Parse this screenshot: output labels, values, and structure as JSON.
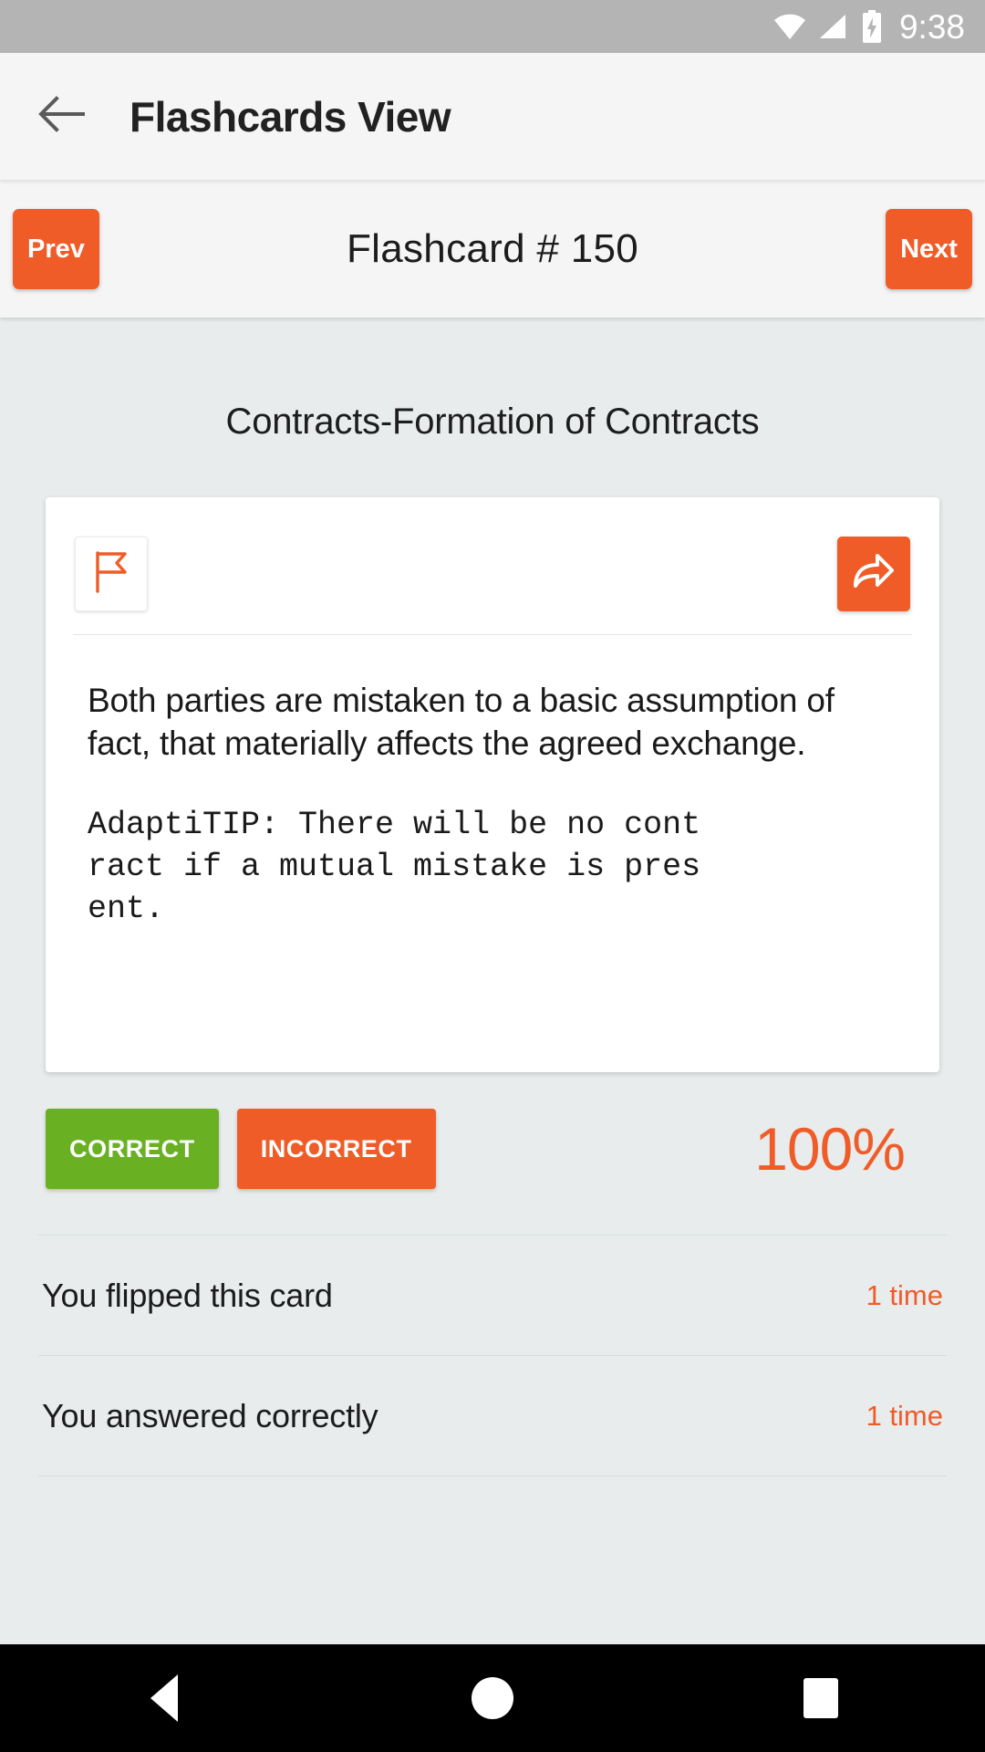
{
  "status_bar": {
    "time": "9:38",
    "icons": [
      "wifi-icon",
      "cell-signal-icon",
      "battery-charging-icon"
    ]
  },
  "app_bar": {
    "back_icon": "arrow-left-icon",
    "title": "Flashcards View"
  },
  "pager": {
    "prev_label": "Prev",
    "next_label": "Next",
    "title": "Flashcard # 150"
  },
  "deck": {
    "title": "Contracts-Formation of Contracts"
  },
  "card": {
    "flag_icon": "flag-icon",
    "share_icon": "share-arrow-icon",
    "paragraph": "Both parties are mistaken to a basic assumption of fact, that materially affects the agreed exchange.",
    "tip": "AdaptiTIP: There will be no cont\nract if a mutual mistake is pres\nent."
  },
  "answers": {
    "correct_label": "CORRECT",
    "incorrect_label": "INCORRECT",
    "percent": "100%"
  },
  "stats": [
    {
      "label": "You flipped this card",
      "value": "1 time"
    },
    {
      "label": "You answered correctly",
      "value": "1 time"
    }
  ],
  "nav_bar": {
    "back": "triangle-back-icon",
    "home": "circle-home-icon",
    "recents": "square-recents-icon"
  },
  "colors": {
    "accent": "#ef5c28",
    "correct_green": "#6ab023",
    "status_bar": "#b4b4b4",
    "app_bar": "#f5f5f5",
    "content_bg": "#e8ecec"
  }
}
